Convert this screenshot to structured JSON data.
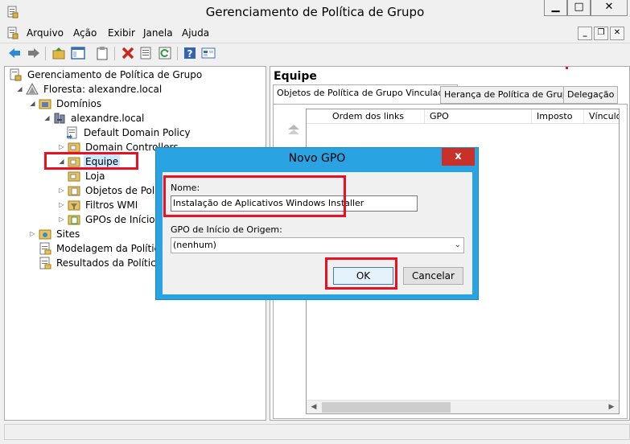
{
  "window": {
    "title": "Gerenciamento de Política de Grupo"
  },
  "menu": {
    "items": [
      "Arquivo",
      "Ação",
      "Exibir",
      "Janela",
      "Ajuda"
    ]
  },
  "tree": {
    "root": "Gerenciamento de Política de Grupo",
    "forest": "Floresta: alexandre.local",
    "domains": "Domínios",
    "domain": "alexandre.local",
    "ddp": "Default Domain Policy",
    "dc": "Domain Controllers",
    "equipe": "Equipe",
    "loja": "Loja",
    "gpo_objects": "Objetos de Polít",
    "wmi": "Filtros WMI",
    "starter": "GPOs de Início",
    "sites": "Sites",
    "modeling": "Modelagem da Política",
    "results": "Resultados da Política d"
  },
  "detail": {
    "title": "Equipe",
    "tabs": [
      "Objetos de Política de Grupo Vinculados",
      "Herança de Política de Grupo",
      "Delegação"
    ],
    "columns": [
      "Ordem dos links",
      "GPO",
      "Imposto",
      "Vínculo"
    ]
  },
  "dialog": {
    "title": "Novo GPO",
    "close": "x",
    "name_label": "Nome:",
    "name_value": "Instalação de Aplicativos Windows Installer",
    "source_label": "GPO de Início de Origem:",
    "source_value": "(nenhum)",
    "ok": "OK",
    "cancel": "Cancelar"
  },
  "colors": {
    "highlight": "#e81123",
    "dialog_frame": "#2aa3e3",
    "close_button": "#c7312a"
  }
}
